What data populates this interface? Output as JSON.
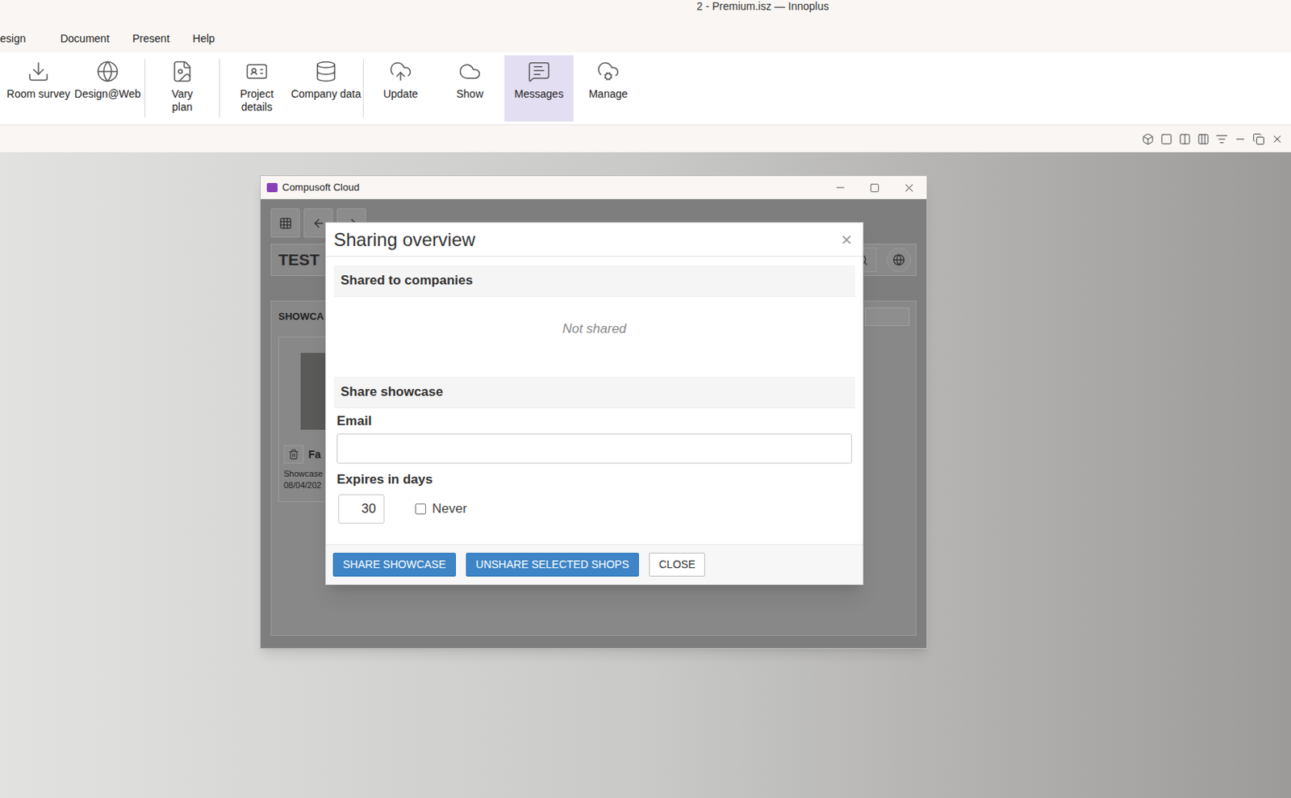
{
  "window": {
    "title": "2 - Premium.isz — Innoplus"
  },
  "menu": [
    {
      "label": "esign"
    },
    {
      "label": "Document"
    },
    {
      "label": "Present"
    },
    {
      "label": "Help"
    }
  ],
  "ribbon": {
    "groups": [
      [
        {
          "lines": [
            "Room survey"
          ],
          "selected": false
        },
        {
          "lines": [
            "Design@Web"
          ],
          "selected": false
        }
      ],
      [
        {
          "lines": [
            "Vary",
            "plan"
          ],
          "selected": false
        }
      ],
      [
        {
          "lines": [
            "Project",
            "details"
          ],
          "selected": false
        },
        {
          "lines": [
            "Company data"
          ],
          "selected": false
        }
      ],
      [
        {
          "lines": [
            "Update"
          ],
          "selected": false
        },
        {
          "lines": [
            "Show"
          ],
          "selected": false
        },
        {
          "lines": [
            "Messages"
          ],
          "selected": true
        },
        {
          "lines": [
            "Manage"
          ],
          "selected": false
        }
      ]
    ]
  },
  "cloud_window": {
    "title": "Compusoft Cloud",
    "project": "TEST",
    "section": "SHOWCA",
    "card": {
      "name": "Fa",
      "type": "Showcase",
      "date": "08/04/202"
    }
  },
  "modal": {
    "title": "Sharing overview",
    "close": "×",
    "shared_heading": "Shared to companies",
    "shared_empty": "Not shared",
    "share_heading": "Share showcase",
    "email_label": "Email",
    "email_value": "",
    "expires_label": "Expires in days",
    "expires_value": "30",
    "never": {
      "label": "Never",
      "checked": false
    },
    "buttons": [
      {
        "label": "SHARE SHOWCASE",
        "kind": "primary"
      },
      {
        "label": "UNSHARE SELECTED SHOPS",
        "kind": "primary"
      },
      {
        "label": "CLOSE",
        "kind": "default"
      }
    ]
  }
}
